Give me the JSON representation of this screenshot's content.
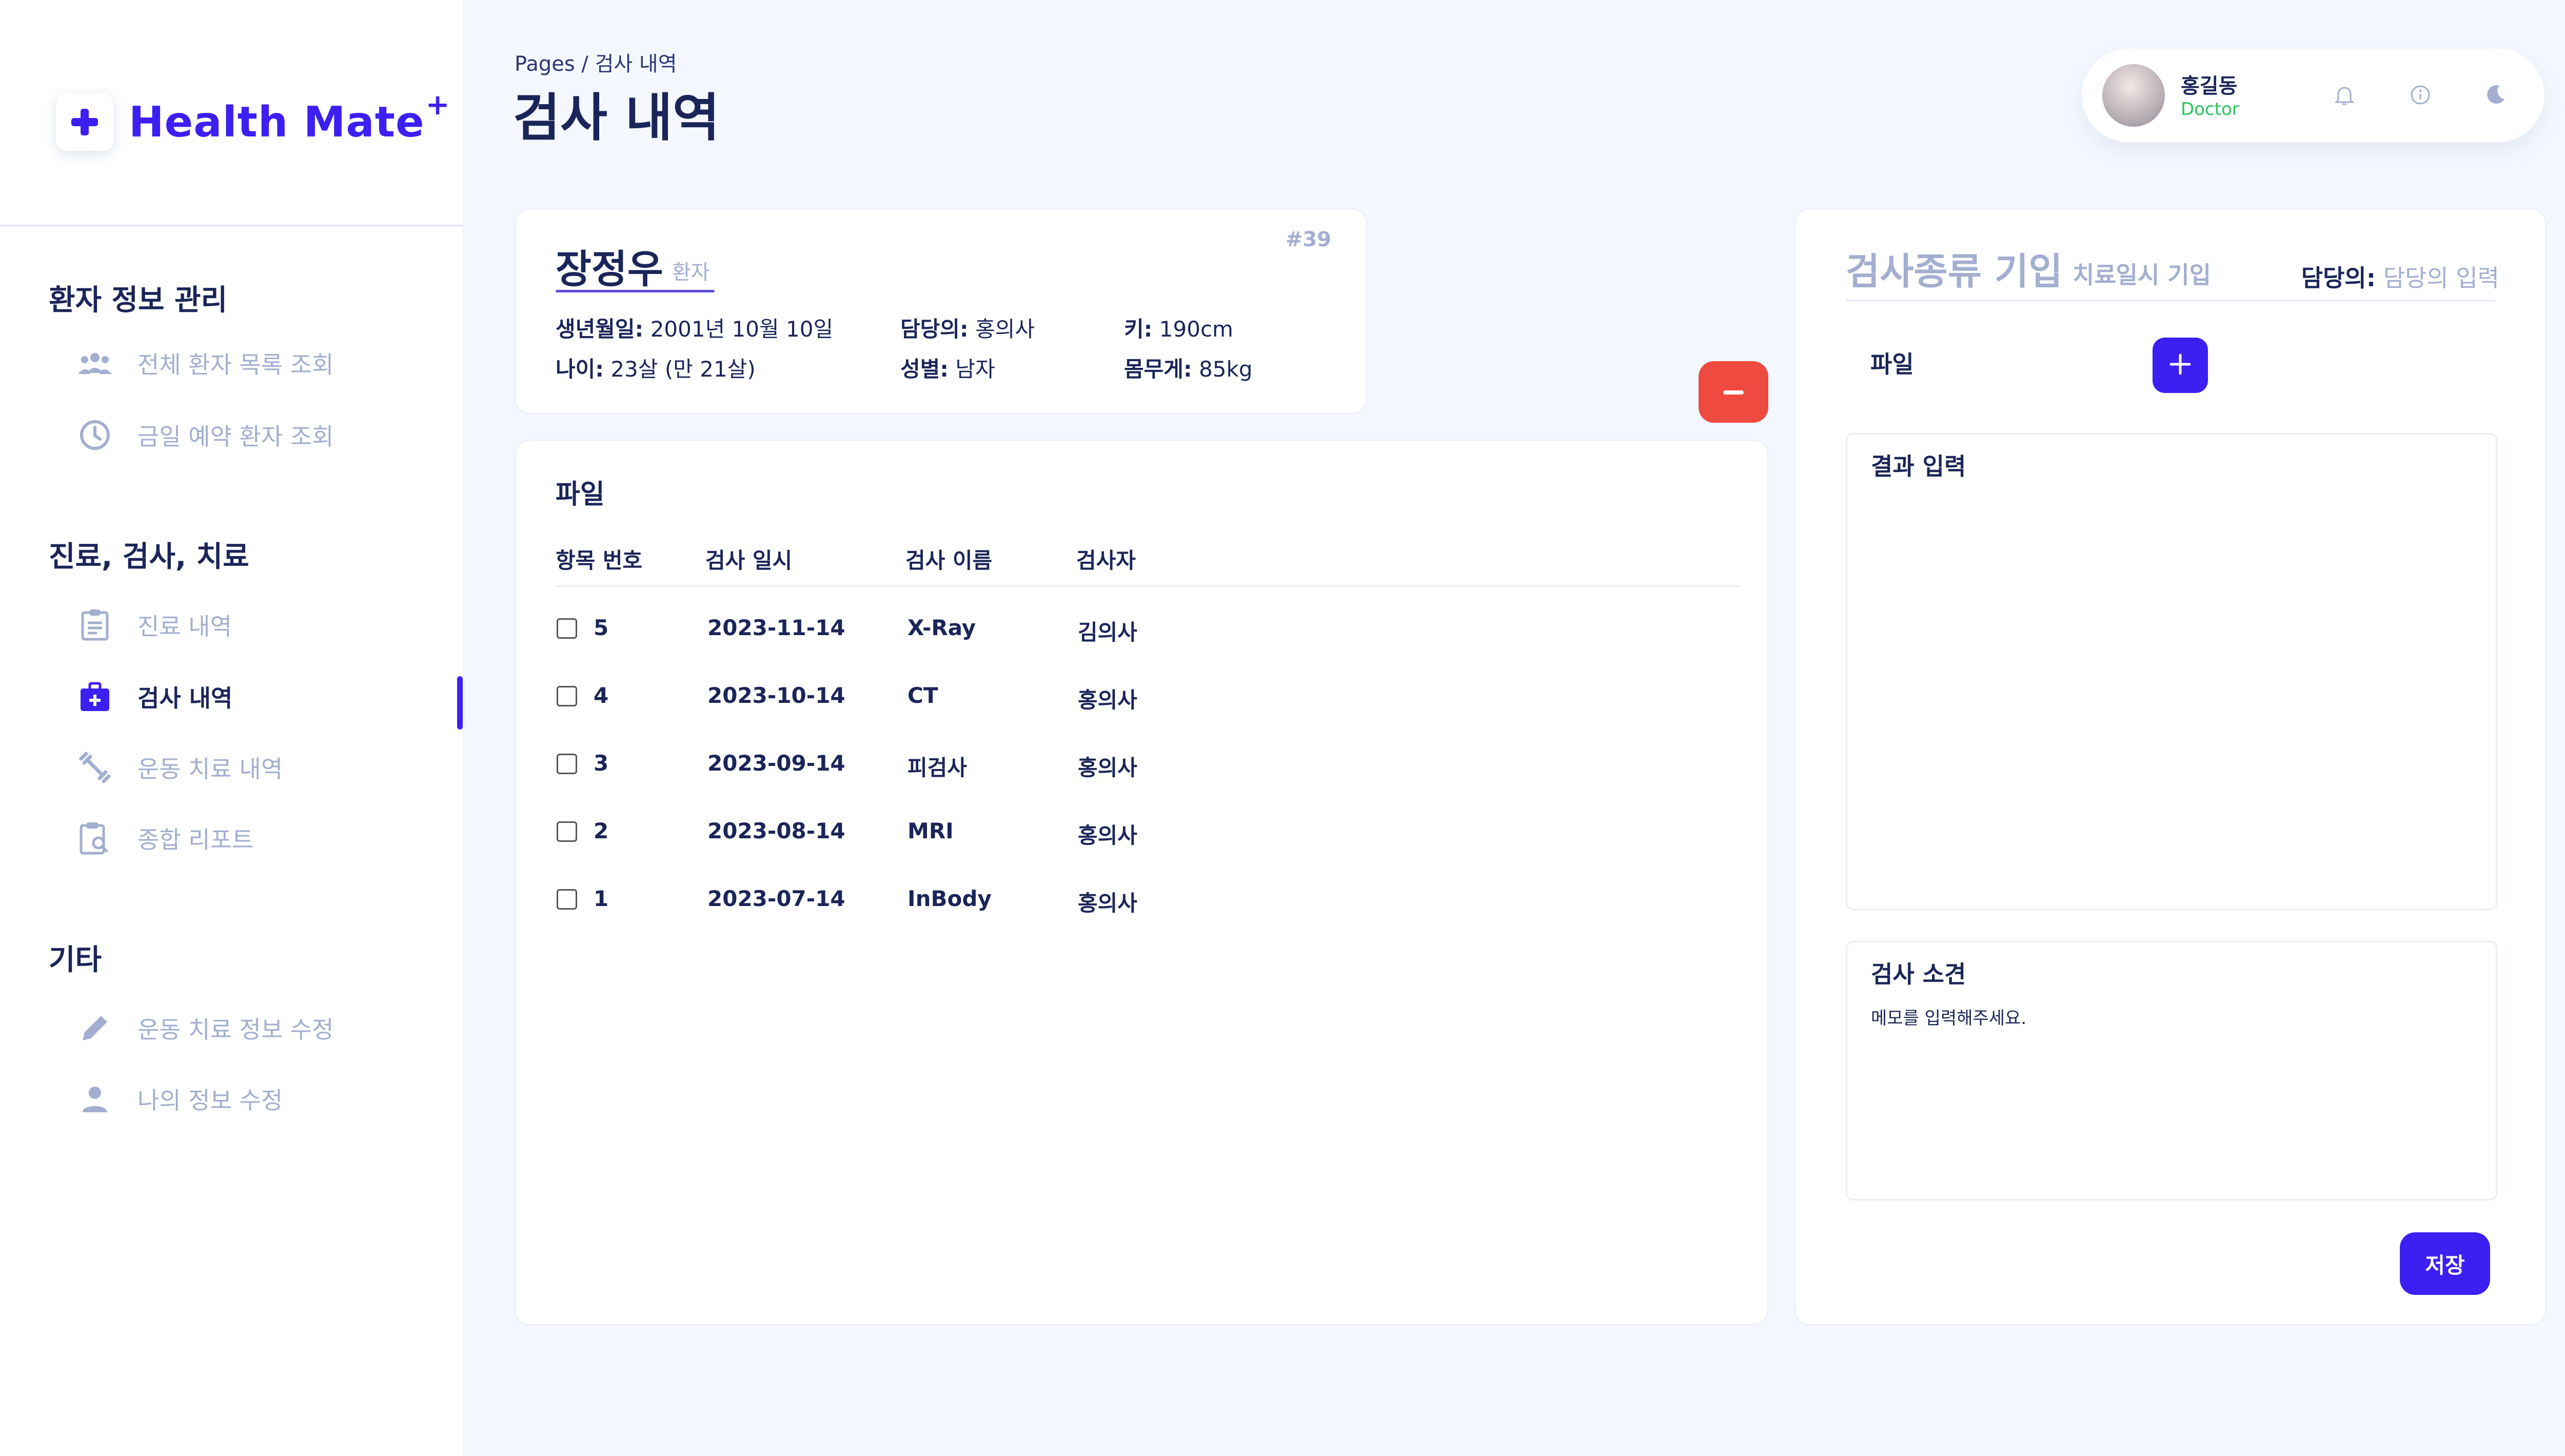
{
  "app": {
    "logo_text": "Health Mate",
    "logo_plus": "+"
  },
  "sidebar": {
    "sections": [
      {
        "title": "환자 정보 관리",
        "items": [
          {
            "label": "전체 환자 목록 조회",
            "icon": "group-icon"
          },
          {
            "label": "금일 예약 환자 조회",
            "icon": "clock-icon"
          }
        ]
      },
      {
        "title": "진료, 검사, 치료",
        "items": [
          {
            "label": "진료 내역",
            "icon": "clipboard-icon"
          },
          {
            "label": "검사 내역",
            "icon": "medical-bag-icon",
            "active": true
          },
          {
            "label": "운동 치료 내역",
            "icon": "dumbbell-icon"
          },
          {
            "label": "종합 리포트",
            "icon": "report-search-icon"
          }
        ]
      },
      {
        "title": "기타",
        "items": [
          {
            "label": "운동 치료 정보 수정",
            "icon": "pencil-icon"
          },
          {
            "label": "나의 정보 수정",
            "icon": "person-icon"
          }
        ]
      }
    ]
  },
  "header": {
    "breadcrumb": "Pages  /  검사 내역",
    "title": "검사 내역"
  },
  "user": {
    "name": "홍길동",
    "role": "Doctor"
  },
  "patient": {
    "name": "장정우",
    "role": "환자",
    "id": "#39",
    "birth_label": "생년월일:",
    "birth": " 2001년 10월 10일",
    "age_label": "나이:",
    "age": " 23살 (만 21살)",
    "doctor_label": "담당의:",
    "doctor": " 홍의사",
    "gender_label": "성별:",
    "gender": " 남자",
    "height_label": "키:",
    "height": " 190cm",
    "weight_label": "몸무게:",
    "weight": " 85kg"
  },
  "files": {
    "title": "파일",
    "columns": [
      "항목 번호",
      "검사 일시",
      "검사 이름",
      "검사자"
    ],
    "rows": [
      {
        "no": "5",
        "date": "2023-11-14",
        "name": "X-Ray",
        "examiner": "김의사"
      },
      {
        "no": "4",
        "date": "2023-10-14",
        "name": "CT",
        "examiner": "홍의사"
      },
      {
        "no": "3",
        "date": "2023-09-14",
        "name": "피검사",
        "examiner": "홍의사"
      },
      {
        "no": "2",
        "date": "2023-08-14",
        "name": "MRI",
        "examiner": "홍의사"
      },
      {
        "no": "1",
        "date": "2023-07-14",
        "name": "InBody",
        "examiner": "홍의사"
      }
    ]
  },
  "form": {
    "title": "검사종류 기입",
    "subtitle": "치료일시 기입",
    "doctor_label": "담당의:",
    "doctor_placeholder": " 담당의 입력",
    "file_label": "파일",
    "result_label": "결과 입력",
    "opinion_label": "검사 소견",
    "opinion_placeholder": "메모를 입력해주세요.",
    "save_label": "저장"
  },
  "colors": {
    "accent": "#3d1ff2",
    "danger": "#ee4a3f",
    "muted": "#a3aed0",
    "text": "#1b2559",
    "role_green": "#27c45a"
  }
}
